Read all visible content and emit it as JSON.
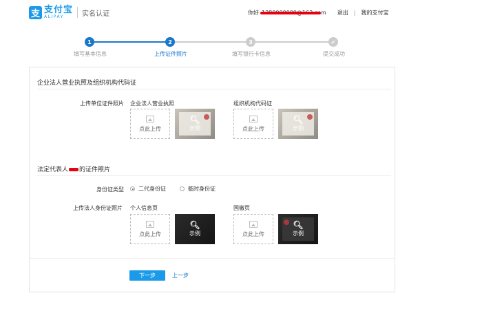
{
  "header": {
    "logo_mark": "支",
    "logo_cn": "支付宝",
    "logo_en": "ALIPAY",
    "page_name": "实名认证",
    "greeting": "你好",
    "user_email": "1380000000@163.com",
    "logout": "退出",
    "separator": "|",
    "my_alipay": "我的支付宝"
  },
  "steps": [
    {
      "num": "1",
      "label": "填写基本信息",
      "state": "done"
    },
    {
      "num": "2",
      "label": "上传证件照片",
      "state": "current"
    },
    {
      "num": "3",
      "label": "填写银行卡信息",
      "state": "todo"
    },
    {
      "num": "✔",
      "label": "提交成功",
      "state": "todo"
    }
  ],
  "section1": {
    "title": "企业法人营业执照及组织机构代码证",
    "row_label": "上传单位证件照片",
    "item1_label": "企业法人营业执照",
    "item2_label": "组织机构代码证"
  },
  "section2": {
    "title_prefix": "法定代表人",
    "title_suffix": "的证件照片",
    "id_type_label": "身份证类型",
    "radio1": "二代身份证",
    "radio2": "临时身份证",
    "row_label": "上传法人身份证照片",
    "item1_label": "个人信息页",
    "item2_label": "国徽页"
  },
  "upload": {
    "text": "点此上传"
  },
  "sample": {
    "text": "示例",
    "icon": "search-icon"
  },
  "buttons": {
    "next": "下一步",
    "prev": "上一步"
  },
  "colors": {
    "brand": "#1a9ae8",
    "step_active": "#1a77c9",
    "redaction": "#e60012"
  }
}
